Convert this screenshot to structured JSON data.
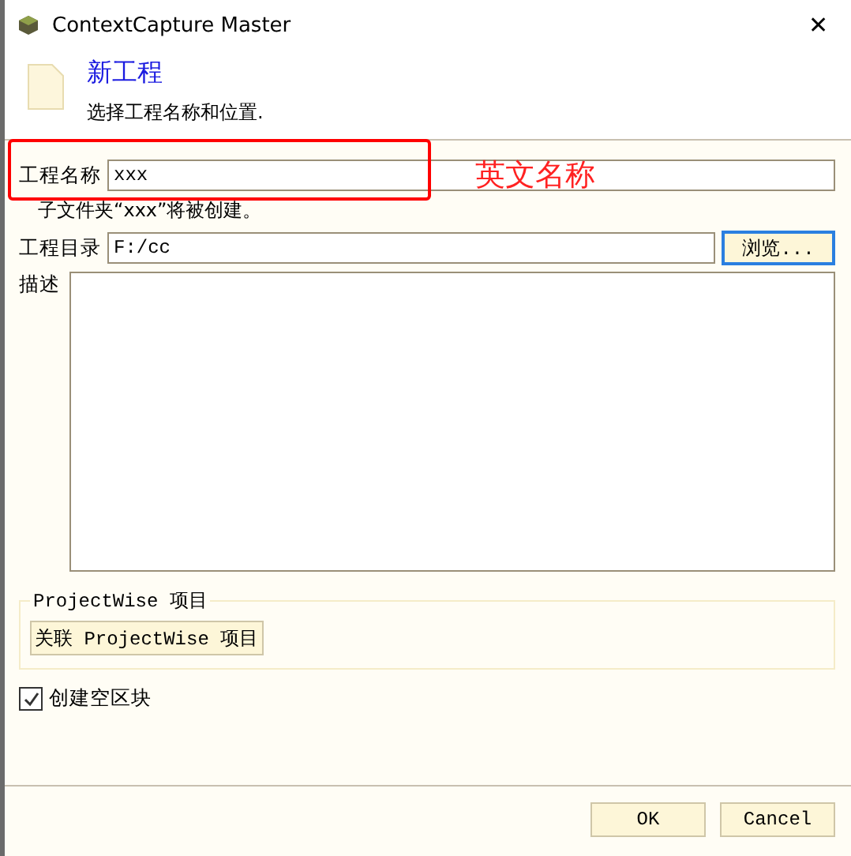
{
  "window": {
    "title": "ContextCapture Master",
    "close": "✕"
  },
  "header": {
    "title": "新工程",
    "subtitle": "选择工程名称和位置."
  },
  "form": {
    "name_label": "工程名称",
    "name_value": "xxx",
    "note": "子文件夹“xxx”将被创建。",
    "dir_label": "工程目录",
    "dir_value": "F:/cc",
    "browse": "浏览...",
    "description_label": "描述"
  },
  "annotation": {
    "text": "英文名称"
  },
  "projectwise": {
    "title": "ProjectWise 项目",
    "button": "关联 ProjectWise 项目"
  },
  "create_empty_block": {
    "label": "创建空区块",
    "checked": true
  },
  "buttons": [
    "OK",
    "Cancel"
  ]
}
